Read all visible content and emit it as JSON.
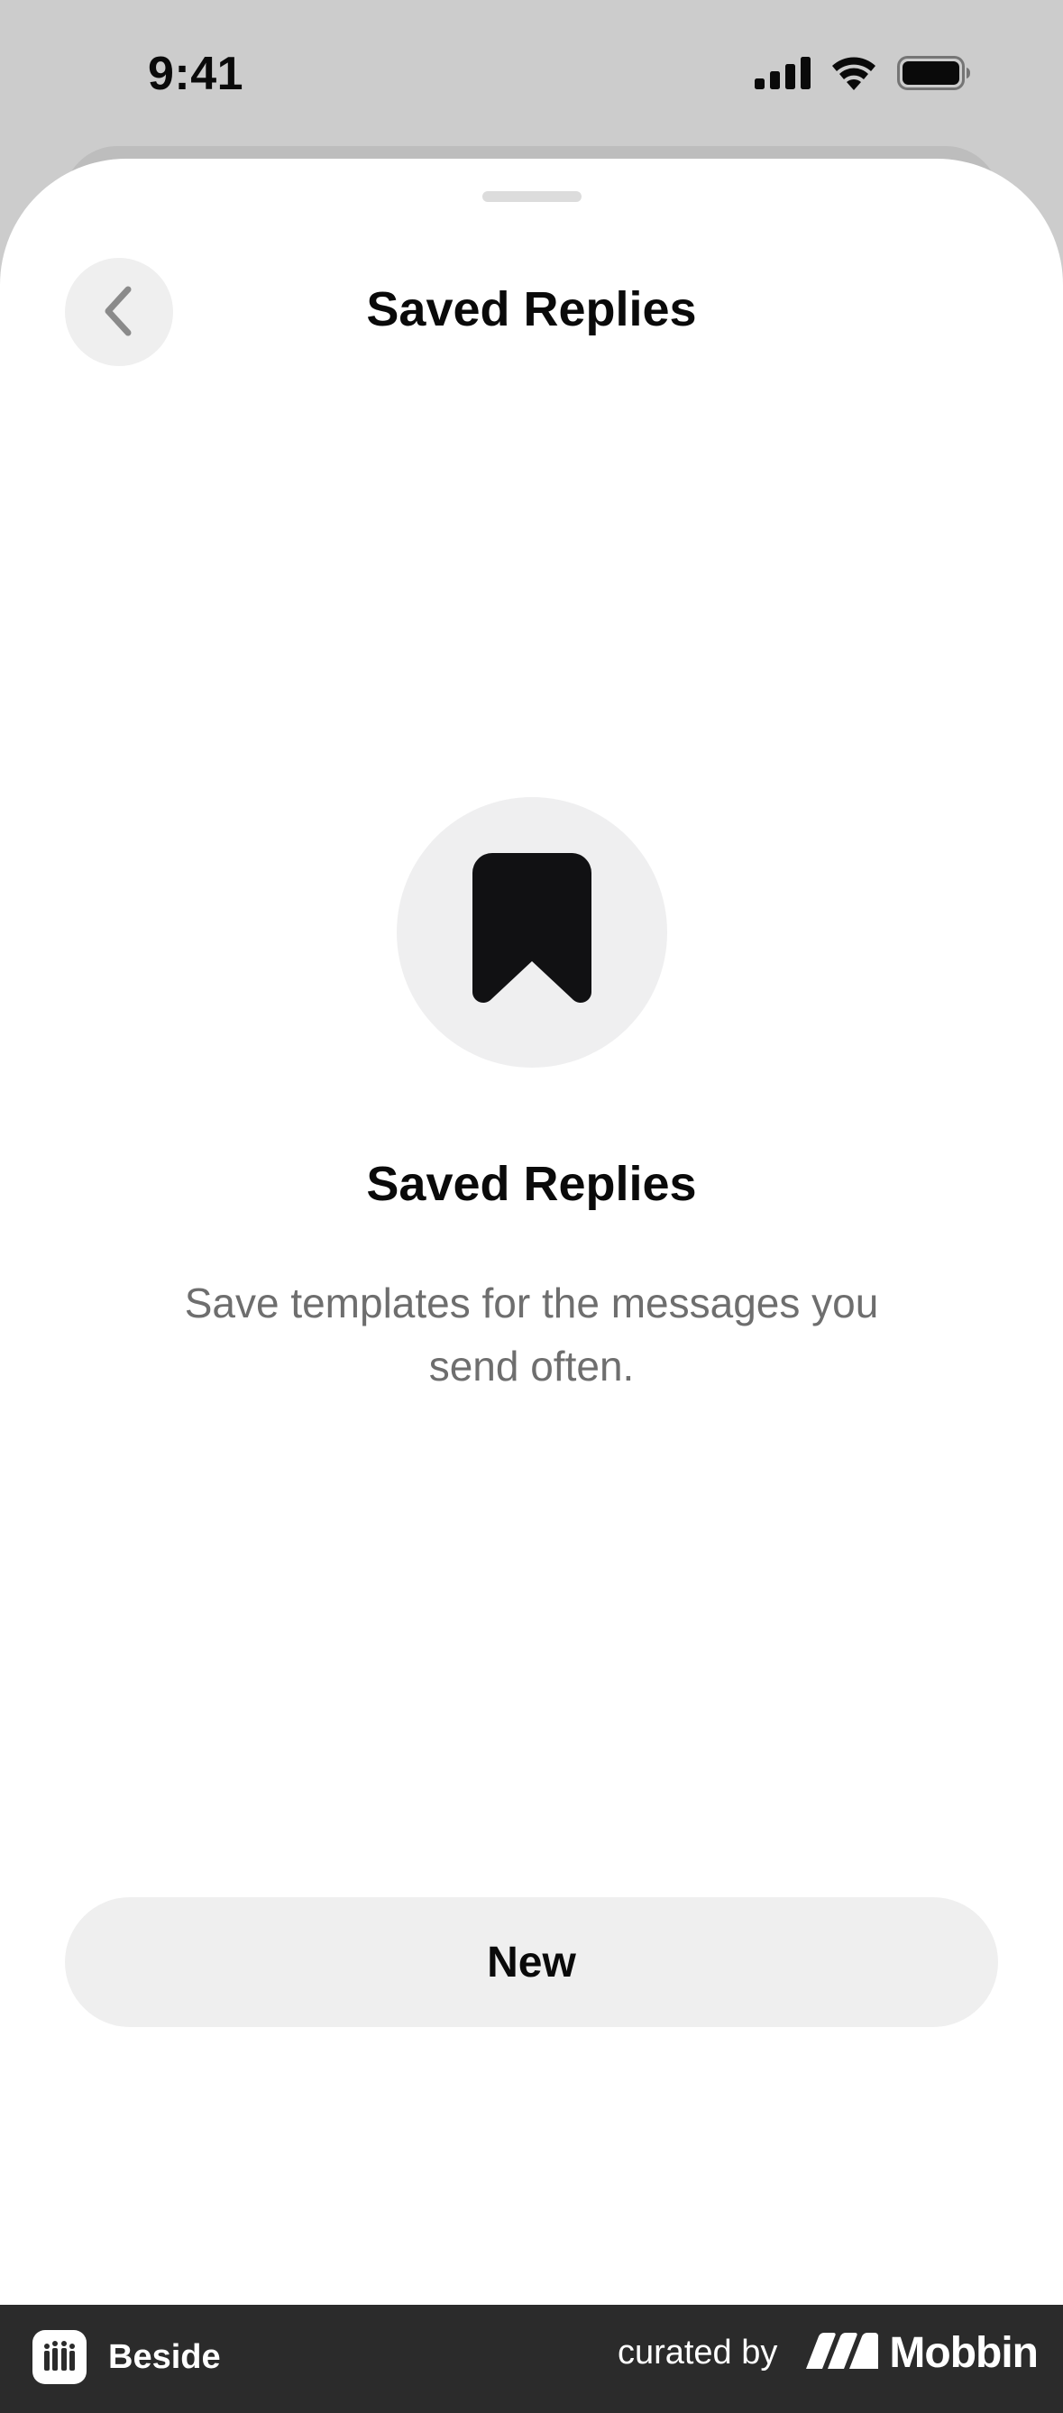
{
  "status_bar": {
    "time": "9:41",
    "icons": [
      "cellular-signal-icon",
      "wifi-icon",
      "battery-icon"
    ]
  },
  "header": {
    "title": "Saved Replies",
    "back_icon": "chevron-left-icon"
  },
  "empty_state": {
    "icon": "bookmark-icon",
    "title": "Saved Replies",
    "description": "Save templates for the messages you send often."
  },
  "actions": {
    "new_label": "New"
  },
  "footer": {
    "app_name": "Beside",
    "curated_by": "curated by",
    "brand": "Mobbin"
  },
  "colors": {
    "sheet": "#ffffff",
    "backdrop": "#cccccc",
    "button_bg": "#efefef",
    "text_primary": "#0a0a0a",
    "text_secondary": "#6e6e6e",
    "footer_bg": "#2b2b2b"
  }
}
